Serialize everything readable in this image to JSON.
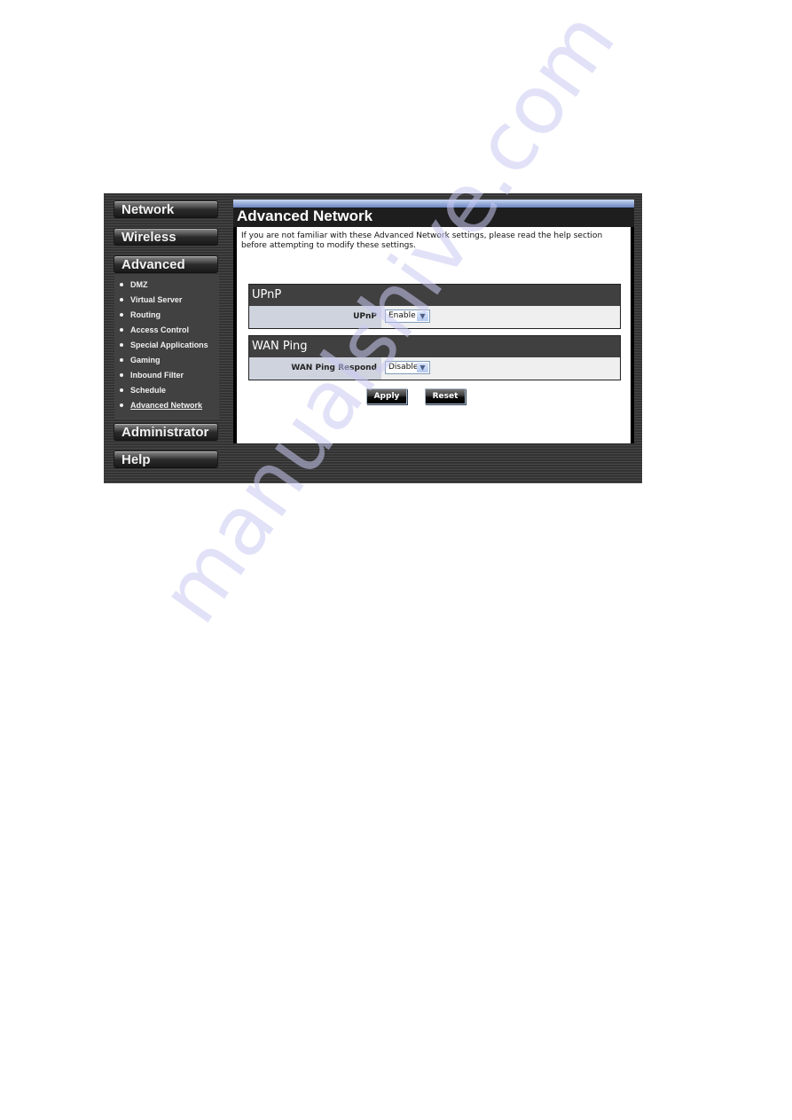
{
  "sidebar": {
    "main_buttons": [
      {
        "label": "Network"
      },
      {
        "label": "Wireless"
      },
      {
        "label": "Advanced"
      },
      {
        "label": "Administrator"
      },
      {
        "label": "Help"
      }
    ],
    "advanced_items": [
      {
        "label": "DMZ"
      },
      {
        "label": "Virtual Server"
      },
      {
        "label": "Routing"
      },
      {
        "label": "Access Control"
      },
      {
        "label": "Special Applications"
      },
      {
        "label": "Gaming"
      },
      {
        "label": "Inbound Filter"
      },
      {
        "label": "Schedule"
      },
      {
        "label": "Advanced Network",
        "active": true
      }
    ]
  },
  "content": {
    "title": "Advanced Network",
    "intro": "If you are not familiar with these Advanced Network settings, please read the help section before attempting to modify these settings.",
    "sections": [
      {
        "heading": "UPnP",
        "field_label": "UPnP",
        "selected_value": "Enable"
      },
      {
        "heading": "WAN Ping",
        "field_label": "WAN Ping Respond",
        "selected_value": "Disable"
      }
    ],
    "buttons": {
      "apply": "Apply",
      "reset": "Reset"
    }
  },
  "icons": {
    "bullet": "•",
    "dropdown_arrow": "▼"
  },
  "watermark": "manualshive.com"
}
